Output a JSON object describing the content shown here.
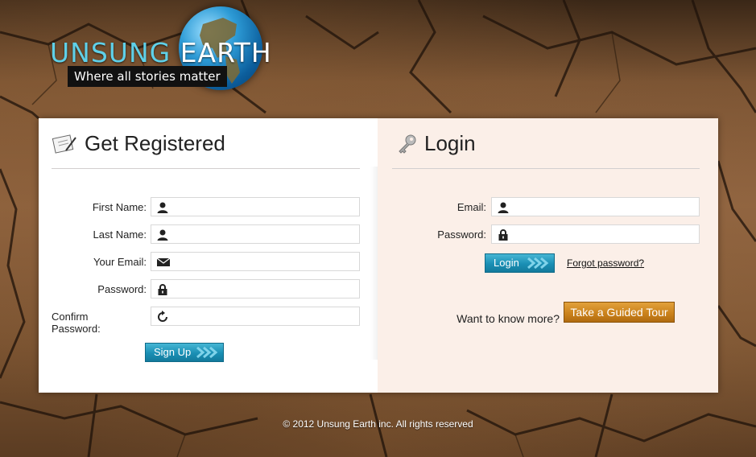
{
  "brand": {
    "title_part1": "UNSUNG",
    "title_part2": "EARTH",
    "tagline": "Where all stories matter"
  },
  "register": {
    "title": "Get Registered",
    "fields": [
      {
        "label": "First Name:",
        "icon": "user-icon",
        "value": ""
      },
      {
        "label": "Last Name:",
        "icon": "user-icon",
        "value": ""
      },
      {
        "label": "Your Email:",
        "icon": "envelope-icon",
        "value": ""
      },
      {
        "label": "Password:",
        "icon": "lock-icon",
        "value": ""
      },
      {
        "label": "Confirm Password:",
        "icon": "refresh-icon",
        "value": ""
      }
    ],
    "submit_label": "Sign Up"
  },
  "login": {
    "title": "Login",
    "fields": [
      {
        "label": "Email:",
        "icon": "user-icon",
        "value": ""
      },
      {
        "label": "Password:",
        "icon": "lock-icon",
        "value": ""
      }
    ],
    "submit_label": "Login",
    "forgot_label": "Forgot password?",
    "tour_prompt": "Want to know more?",
    "tour_label": "Take a Guided Tour"
  },
  "footer": {
    "copyright": "© 2012 Unsung Earth inc. All rights reserved"
  },
  "colors": {
    "accent_blue": "#1a8fb4",
    "accent_orange": "#c9801a",
    "login_panel_bg": "#fbefe8"
  }
}
